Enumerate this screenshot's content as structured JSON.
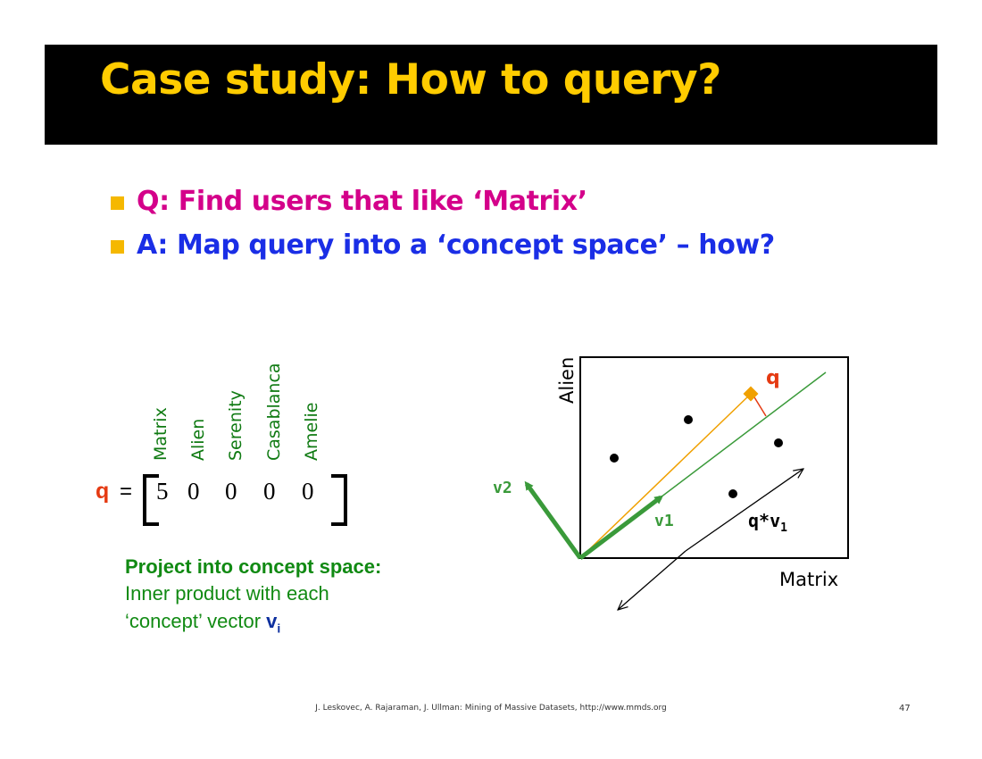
{
  "slide": {
    "title": "Case study: How to query?",
    "bullets": [
      "Q: Find users that like ‘Matrix’",
      "A: Map query into a ‘concept space’ – how?"
    ]
  },
  "query_vector": {
    "label": "q",
    "equals": "=",
    "columns": [
      "Matrix",
      "Alien",
      "Serenity",
      "Casablanca",
      "Amelie"
    ],
    "values": [
      "5",
      "0",
      "0",
      "0",
      "0"
    ]
  },
  "projection_note": {
    "heading": "Project into concept space:",
    "line2": "Inner product  with each",
    "line3_prefix": "‘concept’ vector ",
    "vector_symbol": "v",
    "vector_subscript": "i"
  },
  "diagram": {
    "x_axis_label": "Matrix",
    "y_axis_label": "Alien",
    "q_label": "q",
    "v1_label": "v1",
    "v2_label": "v2",
    "qv1_label": "q*v",
    "qv1_subscript": "1"
  },
  "colors": {
    "title": "#ffcc00",
    "question": "#d4008a",
    "answer": "#1a2ee6",
    "concept_green": "#3a9a3a",
    "query_orange": "#f0a000",
    "q_red": "#e53a12"
  },
  "footer": {
    "citation": "J. Leskovec, A. Rajaraman, J. Ullman: Mining of Massive Datasets, http://www.mmds.org",
    "page_number": "47"
  }
}
